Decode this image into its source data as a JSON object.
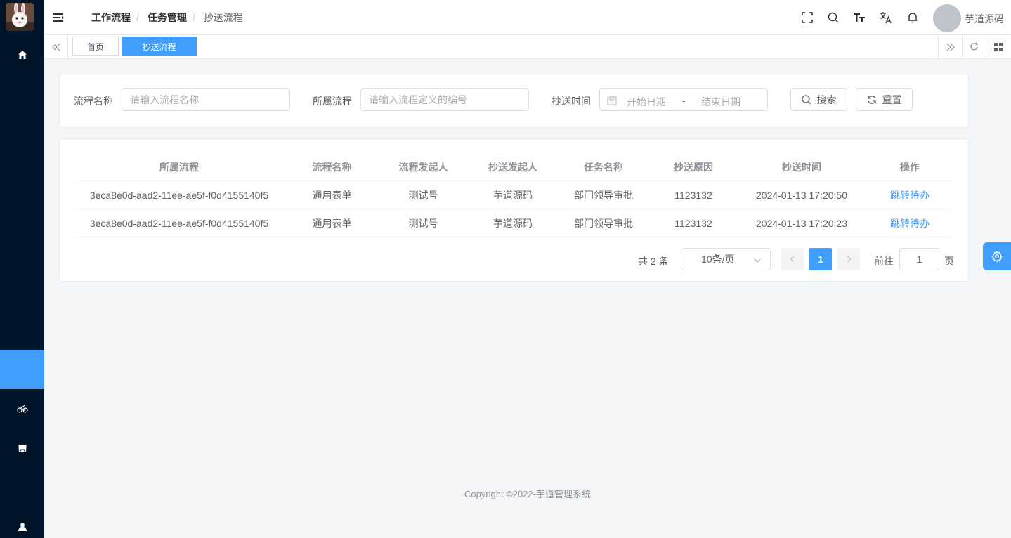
{
  "header": {
    "breadcrumb": [
      "工作流程",
      "任务管理",
      "抄送流程"
    ],
    "breadcrumb_sep": "/",
    "username": "芋道源码"
  },
  "tags": {
    "home": "首页",
    "active": "抄送流程"
  },
  "search": {
    "process_name_label": "流程名称",
    "process_name_placeholder": "请输入流程名称",
    "process_label": "所属流程",
    "process_placeholder": "请输入流程定义的编号",
    "time_label": "抄送时间",
    "start_placeholder": "开始日期",
    "range_sep": "-",
    "end_placeholder": "结束日期",
    "search_button": "搜索",
    "reset_button": "重置"
  },
  "table": {
    "columns": [
      "所属流程",
      "流程名称",
      "流程发起人",
      "抄送发起人",
      "任务名称",
      "抄送原因",
      "抄送时间",
      "操作"
    ],
    "rows": [
      [
        "3eca8e0d-aad2-11ee-ae5f-f0d4155140f5",
        "通用表单",
        "测试号",
        "芋道源码",
        "部门领导审批",
        "1123132",
        "2024-01-13 17:20:50",
        "跳转待办"
      ],
      [
        "3eca8e0d-aad2-11ee-ae5f-f0d4155140f5",
        "通用表单",
        "测试号",
        "芋道源码",
        "部门领导审批",
        "1123132",
        "2024-01-13 17:20:23",
        "跳转待办"
      ]
    ]
  },
  "pagination": {
    "total_text": "共 2 条",
    "page_size": "10条/页",
    "current_page": "1",
    "goto_label": "前往",
    "goto_value": "1",
    "page_suffix": "页"
  },
  "footer": {
    "copyright": "Copyright ©2022-芋道管理系统"
  },
  "colors": {
    "sidebar_bg": "#001529",
    "accent": "#409eff"
  },
  "icons": {
    "sidebar": [
      "home-icon",
      "bicycle-icon",
      "shop-icon",
      "user-icon"
    ],
    "header": [
      "fullscreen-icon",
      "search-icon",
      "font-size-icon",
      "translate-icon",
      "bell-icon"
    ]
  }
}
